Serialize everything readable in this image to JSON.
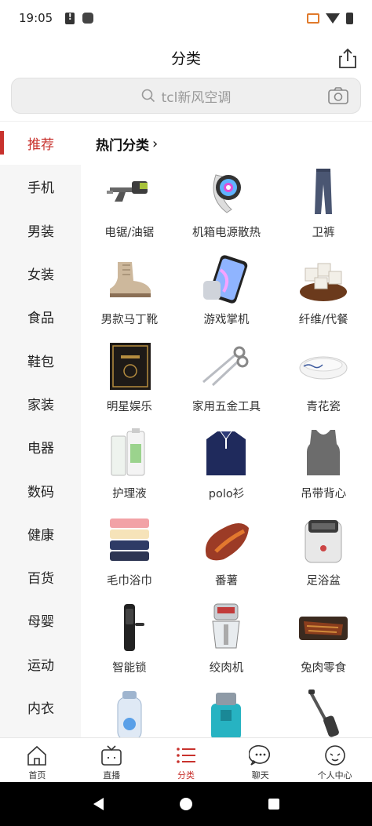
{
  "status_bar": {
    "time": "19:05"
  },
  "header": {
    "title": "分类"
  },
  "search": {
    "placeholder": "tcl新风空调"
  },
  "sidebar": {
    "items": [
      {
        "label": "推荐",
        "active": true
      },
      {
        "label": "手机"
      },
      {
        "label": "男装"
      },
      {
        "label": "女装"
      },
      {
        "label": "食品"
      },
      {
        "label": "鞋包"
      },
      {
        "label": "家装"
      },
      {
        "label": "电器"
      },
      {
        "label": "数码"
      },
      {
        "label": "健康"
      },
      {
        "label": "百货"
      },
      {
        "label": "母婴"
      },
      {
        "label": "运动"
      },
      {
        "label": "内衣"
      }
    ]
  },
  "main": {
    "section_title": "热门分类",
    "categories": [
      {
        "label": "电锯/油锯",
        "icon": "chainsaw-icon"
      },
      {
        "label": "机箱电源散热",
        "icon": "cooling-fan-icon"
      },
      {
        "label": "卫裤",
        "icon": "sweatpants-icon"
      },
      {
        "label": "男款马丁靴",
        "icon": "martin-boots-icon"
      },
      {
        "label": "游戏掌机",
        "icon": "phone-icon"
      },
      {
        "label": "纤维/代餐",
        "icon": "meal-replacement-icon"
      },
      {
        "label": "明星娱乐",
        "icon": "book-icon"
      },
      {
        "label": "家用五金工具",
        "icon": "scissors-icon"
      },
      {
        "label": "青花瓷",
        "icon": "porcelain-plate-icon"
      },
      {
        "label": "护理液",
        "icon": "lotion-bottle-icon"
      },
      {
        "label": "polo衫",
        "icon": "polo-shirt-icon"
      },
      {
        "label": "吊带背心",
        "icon": "tank-top-icon"
      },
      {
        "label": "毛巾浴巾",
        "icon": "towel-stack-icon"
      },
      {
        "label": "番薯",
        "icon": "sweet-potato-icon"
      },
      {
        "label": "足浴盆",
        "icon": "foot-bath-icon"
      },
      {
        "label": "智能锁",
        "icon": "smart-lock-icon"
      },
      {
        "label": "绞肉机",
        "icon": "meat-grinder-icon"
      },
      {
        "label": "兔肉零食",
        "icon": "grilled-meat-icon"
      },
      {
        "label": "",
        "icon": "water-bottle-icon"
      },
      {
        "label": "",
        "icon": "teal-bottle-icon"
      },
      {
        "label": "",
        "icon": "floor-washer-icon"
      }
    ]
  },
  "tabbar": {
    "items": [
      {
        "label": "首页",
        "icon": "home-icon"
      },
      {
        "label": "直播",
        "icon": "tv-icon"
      },
      {
        "label": "分类",
        "icon": "list-icon",
        "active": true
      },
      {
        "label": "聊天",
        "icon": "chat-icon"
      },
      {
        "label": "个人中心",
        "icon": "profile-icon"
      }
    ]
  },
  "colors": {
    "accent": "#c8322d",
    "sidebar_bg": "#f6f6f6",
    "search_bg": "#efefef"
  }
}
